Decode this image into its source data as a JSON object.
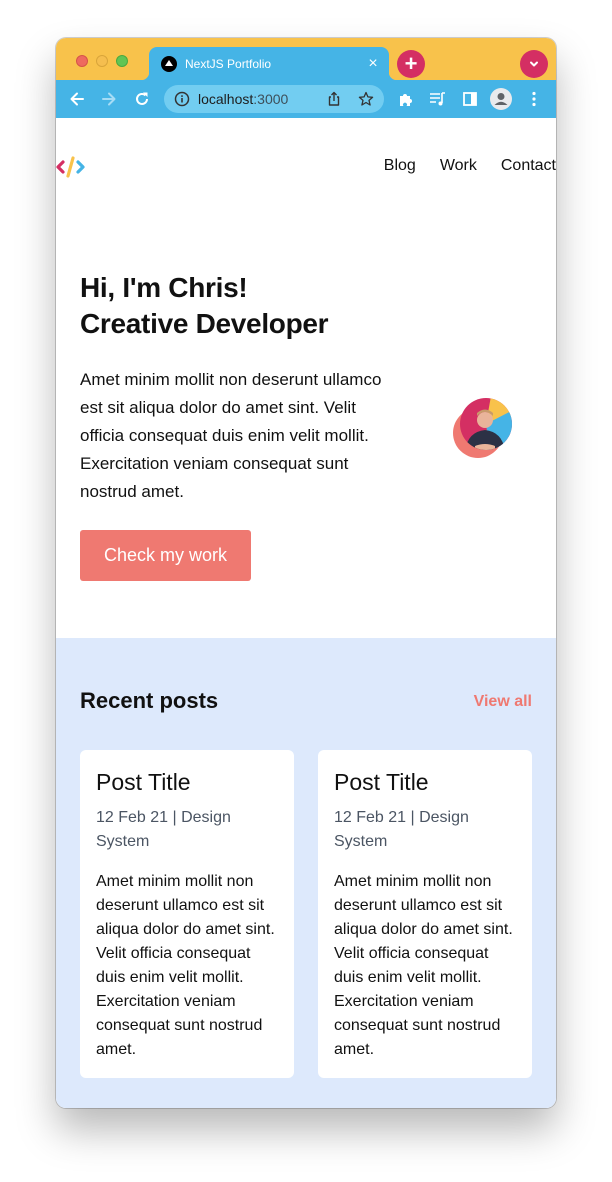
{
  "browser": {
    "tab": {
      "title": "NextJS Portfolio",
      "favicon": "nextjs-icon",
      "close_glyph": "×"
    },
    "new_tab_glyph": "+",
    "url": {
      "host": "localhost",
      "port": ":3000"
    },
    "toolbar_icons": [
      "back-icon",
      "forward-icon",
      "reload-icon",
      "info-icon",
      "share-icon",
      "bookmark-star-icon",
      "extensions-icon",
      "media-queue-icon",
      "side-panel-icon",
      "profile-icon",
      "menu-kebab-icon"
    ],
    "colors": {
      "tabstrip": "#f8c24b",
      "toolbar": "#45b4e6",
      "accent_button": "#d42f63"
    }
  },
  "nav": {
    "logo": "code-brackets-logo",
    "links": [
      {
        "label": "Blog"
      },
      {
        "label": "Work"
      },
      {
        "label": "Contact"
      }
    ]
  },
  "hero": {
    "title_line1": "Hi, I'm Chris!",
    "title_line2": "Creative Developer",
    "text": "Amet minim mollit non deserunt ullamco est sit aliqua dolor do amet sint. Velit officia consequat duis enim velit mollit. Exercitation veniam consequat sunt nostrud amet.",
    "cta_label": "Check my work",
    "colors": {
      "cta": "#ef7971"
    }
  },
  "recent_posts": {
    "title": "Recent posts",
    "view_all_label": "View all",
    "posts": [
      {
        "title": "Post Title",
        "meta": "12 Feb 21 | Design System",
        "body": "Amet minim mollit non deserunt ullamco est sit aliqua dolor do amet sint. Velit officia consequat duis enim velit mollit. Exercitation veniam consequat sunt nostrud amet."
      },
      {
        "title": "Post Title",
        "meta": "12 Feb 21 | Design System",
        "body": "Amet minim mollit non deserunt ullamco est sit aliqua dolor do amet sint. Velit officia consequat duis enim velit mollit. Exercitation veniam consequat sunt nostrud amet."
      }
    ],
    "colors": {
      "section_bg": "#dde9fc",
      "view_all": "#ef7971"
    }
  }
}
